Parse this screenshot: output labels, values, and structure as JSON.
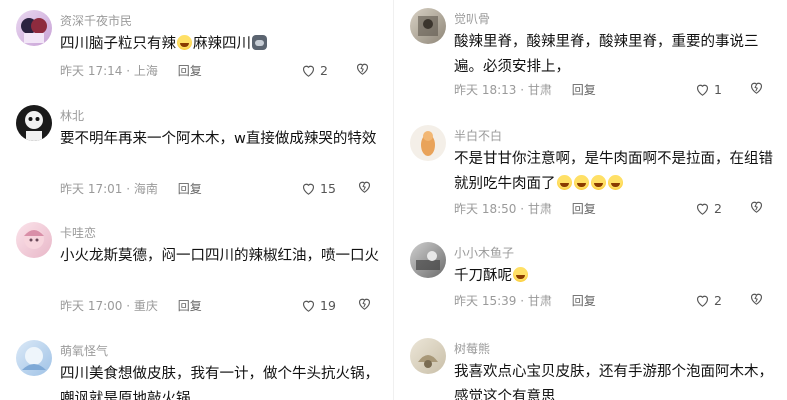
{
  "left_comments": [
    {
      "user": "资深千夜市民",
      "text": "四川脑子粒只有辣",
      "emojis": [
        "laugh"
      ],
      "text_after": "麻辣四川",
      "emojis_after": [
        "cat"
      ],
      "time": "昨天 17:14",
      "location": "上海",
      "reply": "回复",
      "likes": "2"
    },
    {
      "user": "林北",
      "text": "要不明年再来一个阿木木，w直接做成辣哭的特效",
      "emojis": [],
      "text_after": "",
      "emojis_after": [],
      "time": "昨天 17:01",
      "location": "海南",
      "reply": "回复",
      "likes": "15"
    },
    {
      "user": "卡哇恋",
      "text": "小火龙斯莫德，闷一口四川的辣椒红油，喷一口火",
      "emojis": [],
      "text_after": "",
      "emojis_after": [],
      "time": "昨天 17:00",
      "location": "重庆",
      "reply": "回复",
      "likes": "19"
    },
    {
      "user": "萌氧怪气",
      "text": "四川美食想做皮肤，我有一计，做个牛头抗火锅，嘲讽就是原地敲火锅",
      "emojis": [],
      "text_after": "",
      "emojis_after": [],
      "time": "",
      "location": "",
      "reply": "",
      "likes": ""
    }
  ],
  "right_comments": [
    {
      "user": "觉叭骨",
      "text": "酸辣里脊，酸辣里脊，酸辣里脊，重要的事说三遍。必须安排上，",
      "emojis": [],
      "text_after": "",
      "emojis_after": [],
      "time": "昨天 18:13",
      "location": "甘肃",
      "reply": "回复",
      "likes": "1"
    },
    {
      "user": "半白不白",
      "text": "不是甘甘你注意啊，是牛肉面啊不是拉面，在组错就别吃牛肉面了",
      "emojis": [
        "laugh",
        "laugh",
        "laugh",
        "laugh"
      ],
      "text_after": "",
      "emojis_after": [],
      "time": "昨天 18:50",
      "location": "甘肃",
      "reply": "回复",
      "likes": "2"
    },
    {
      "user": "小小木鱼子",
      "text": "千刀酥呢",
      "emojis": [
        "laugh"
      ],
      "text_after": "",
      "emojis_after": [],
      "time": "昨天 15:39",
      "location": "甘肃",
      "reply": "回复",
      "likes": "2"
    },
    {
      "user": "树莓熊",
      "text": "我喜欢点心宝贝皮肤，还有手游那个泡面阿木木，感觉这个有意思",
      "emojis": [],
      "text_after": "",
      "emojis_after": [],
      "time": "",
      "location": "",
      "reply": "",
      "likes": ""
    }
  ],
  "icons": {
    "like": "heart-outline-icon",
    "dislike": "broken-heart-icon"
  },
  "colors": {
    "meta_text": "#9a9a9a",
    "body_text": "#111111",
    "icon": "#555555"
  }
}
